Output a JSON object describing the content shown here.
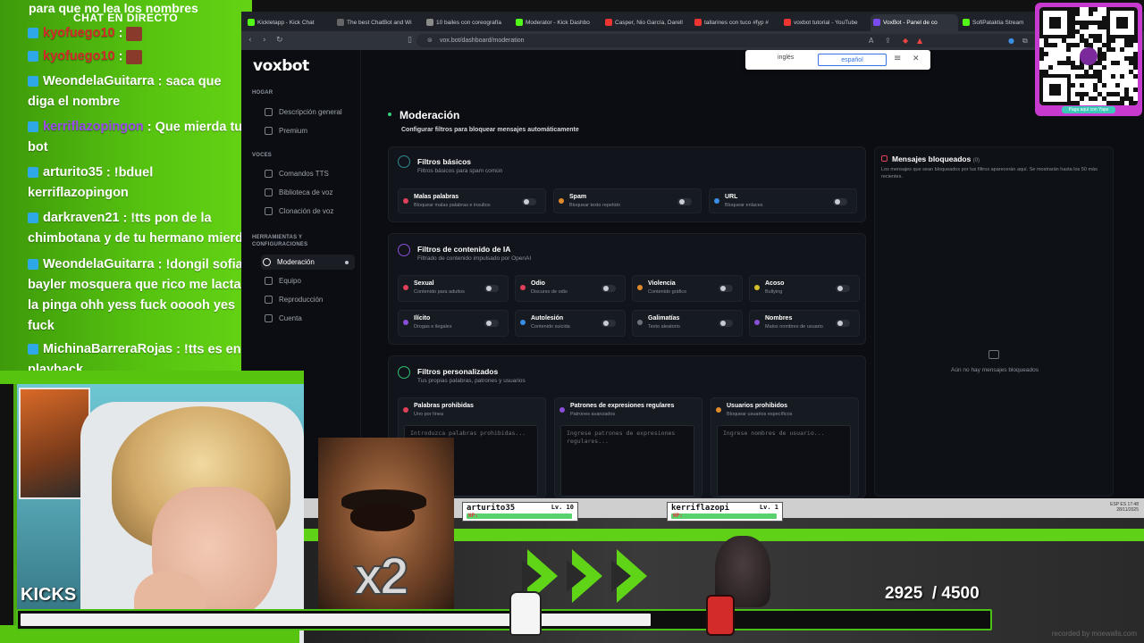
{
  "chat": {
    "topline": "para que no lea los nombres",
    "title": "CHAT EN DIRECTO",
    "messages": [
      {
        "user": "kyofuego10",
        "text": ":",
        "color": "#d12b2b"
      },
      {
        "user": "kyofuego10",
        "text": ":",
        "color": "#d12b2b"
      },
      {
        "user": "WeondelaGuitarra",
        "text": ": saca que diga el nombre",
        "color": "#ffffff"
      },
      {
        "user": "kerriflazopingon",
        "text": ": Que mierda tu bot",
        "color": "#9b4cf0"
      },
      {
        "user": "arturito35",
        "text": ": !bduel kerriflazopingon",
        "color": "#ffffff"
      },
      {
        "user": "darkraven21",
        "text": ": !tts pon de la chimbotana y de tu hermano mierda",
        "color": "#ffffff"
      },
      {
        "user": "WeondelaGuitarra",
        "text": ": !dongil sofia bayler mosquera que rico me lactas la pinga ohh yess fuck ooooh yes fuck",
        "color": "#ffffff"
      },
      {
        "user": "MichinaBarreraRojas",
        "text": ": !tts es en playback",
        "color": "#ffffff"
      }
    ]
  },
  "browser": {
    "tabs": [
      "Kickletapp - Kick Chat",
      "The best ChatBot and Wi",
      "10 bailes con coreografía",
      "Moderator - Kick Dashbo",
      "Casper, Nio García, Darell",
      "tallarines con tuco #fyp #",
      "voxbot tutorial - YouTube",
      "VoxBot - Panel de co",
      "SofiPataktia Stream"
    ],
    "url": "vox.bot/dashboard/moderation",
    "translate": {
      "lang1": "inglés",
      "lang2": "español"
    }
  },
  "app": {
    "logo": "voxbot",
    "sections": {
      "home": "HOGAR",
      "voices": "VOCES",
      "tools": "HERRAMIENTAS Y CONFIGURACIONES"
    },
    "nav": {
      "overview": "Descripción general",
      "premium": "Premium",
      "tts": "Comandos TTS",
      "voicelib": "Biblioteca de voz",
      "clone": "Clonación de voz",
      "moderation": "Moderación",
      "team": "Equipo",
      "playback": "Reproducción",
      "account": "Cuenta"
    },
    "page": {
      "title": "Moderación",
      "subtitle": "Configurar filtros para bloquear mensajes automáticamente"
    },
    "basic": {
      "title": "Filtros básicos",
      "subtitle": "Filtros básicos para spam común",
      "items": [
        {
          "name": "Malas palabras",
          "desc": "Bloquear malas palabras e insultos"
        },
        {
          "name": "Spam",
          "desc": "Bloquear texto repetido"
        },
        {
          "name": "URL",
          "desc": "Bloquear enlaces"
        }
      ]
    },
    "ai": {
      "title": "Filtros de contenido de IA",
      "subtitle": "Filtrado de contenido impulsado por OpenAI",
      "items": [
        {
          "name": "Sexual",
          "desc": "Contenido para adultos"
        },
        {
          "name": "Odio",
          "desc": "Discurso de odio"
        },
        {
          "name": "Violencia",
          "desc": "Contenido gráfico"
        },
        {
          "name": "Acoso",
          "desc": "Bullying"
        },
        {
          "name": "Ilícito",
          "desc": "Drogas e ilegales"
        },
        {
          "name": "Autolesión",
          "desc": "Contenido suicida"
        },
        {
          "name": "Galimatías",
          "desc": "Texto aleatorio"
        },
        {
          "name": "Nombres",
          "desc": "Malos nombres de usuario"
        }
      ]
    },
    "custom": {
      "title": "Filtros personalizados",
      "subtitle": "Tus propias palabras, patrones y usuarios",
      "items": [
        {
          "name": "Palabras prohibidas",
          "desc": "Uno por línea",
          "placeholder": "Introduzca palabras prohibidas..."
        },
        {
          "name": "Patrones de expresiones regulares",
          "desc": "Patrones avanzados",
          "placeholder": "Ingrese patrones de expresiones regulares..."
        },
        {
          "name": "Usuarios prohibidos",
          "desc": "Bloquear usuarios específicos",
          "placeholder": "Ingrese nombres de usuario..."
        }
      ]
    },
    "blocked": {
      "title": "Mensajes bloqueados",
      "count": "(0)",
      "desc": "Los mensajes que sean bloqueados por tus filtros aparecerán aquí. Se mostrarán hasta los 50 más recientes.",
      "empty": "Aún no hay mensajes bloqueados"
    }
  },
  "qr": {
    "label": "Paga aquí con Yape"
  },
  "overlay": {
    "kicks": "KICKS",
    "score": "2925  / 4500",
    "progress_fraction": 0.65,
    "player1": {
      "name": "arturito35",
      "level": "Lv. 10",
      "hp": "HP:"
    },
    "player2": {
      "name": "kerriflazopi",
      "level": "Lv. 1",
      "hp": "HP:"
    },
    "meme_text": "x2",
    "watermark": "recorded by moewalls.com",
    "tray": {
      "lang": "ESP",
      "region": "ES",
      "time": "17:48",
      "date": "28/11/2025"
    }
  },
  "colors": {
    "accent_green": "#57c410",
    "brand_purple": "#c63ad0",
    "dashboard_bg": "#0b0d12"
  }
}
